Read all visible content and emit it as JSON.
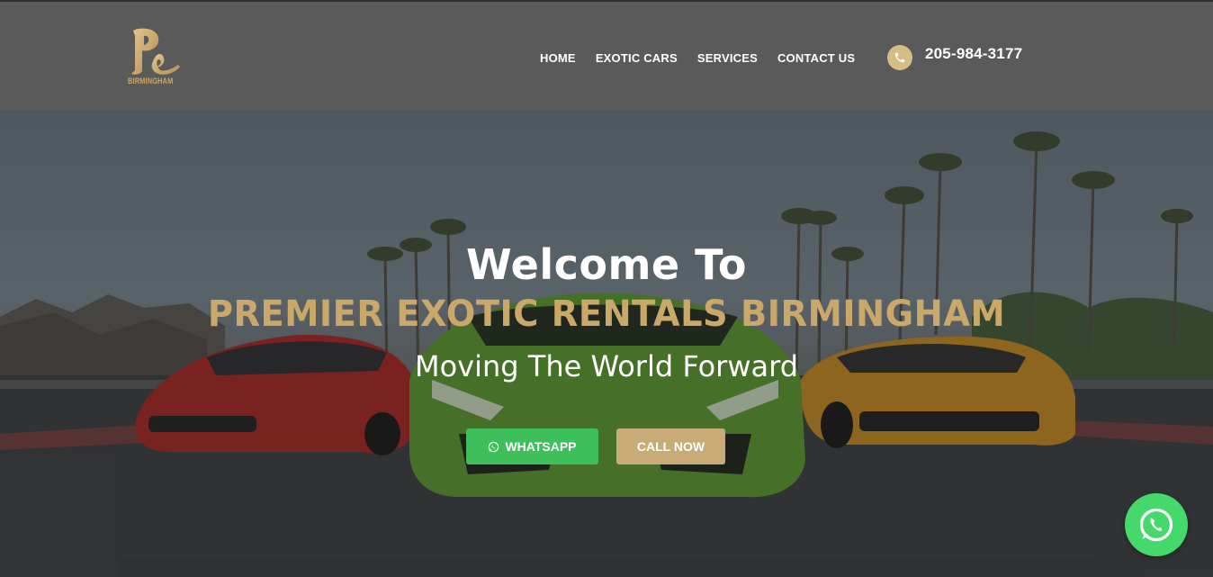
{
  "header": {
    "logo_text": "BIRMINGHAM",
    "nav": [
      {
        "label": "HOME"
      },
      {
        "label": "EXOTIC CARS"
      },
      {
        "label": "SERVICES"
      },
      {
        "label": "CONTACT US"
      }
    ],
    "phone": "205-984-3177",
    "phone_icon": "phone-icon"
  },
  "hero": {
    "welcome": "Welcome To",
    "brand": "PREMIER EXOTIC RENTALS BIRMINGHAM",
    "tagline": "Moving The World Forward",
    "whatsapp_label": "WHATSAPP",
    "call_label": "CALL NOW"
  },
  "colors": {
    "header_bg": "#5b5a5a",
    "gold": "#c9a86a",
    "whatsapp_green": "#3fbf5b",
    "call_button": "#c9ab77",
    "float_whatsapp": "#45d86a"
  },
  "floating": {
    "icon": "whatsapp-icon"
  }
}
